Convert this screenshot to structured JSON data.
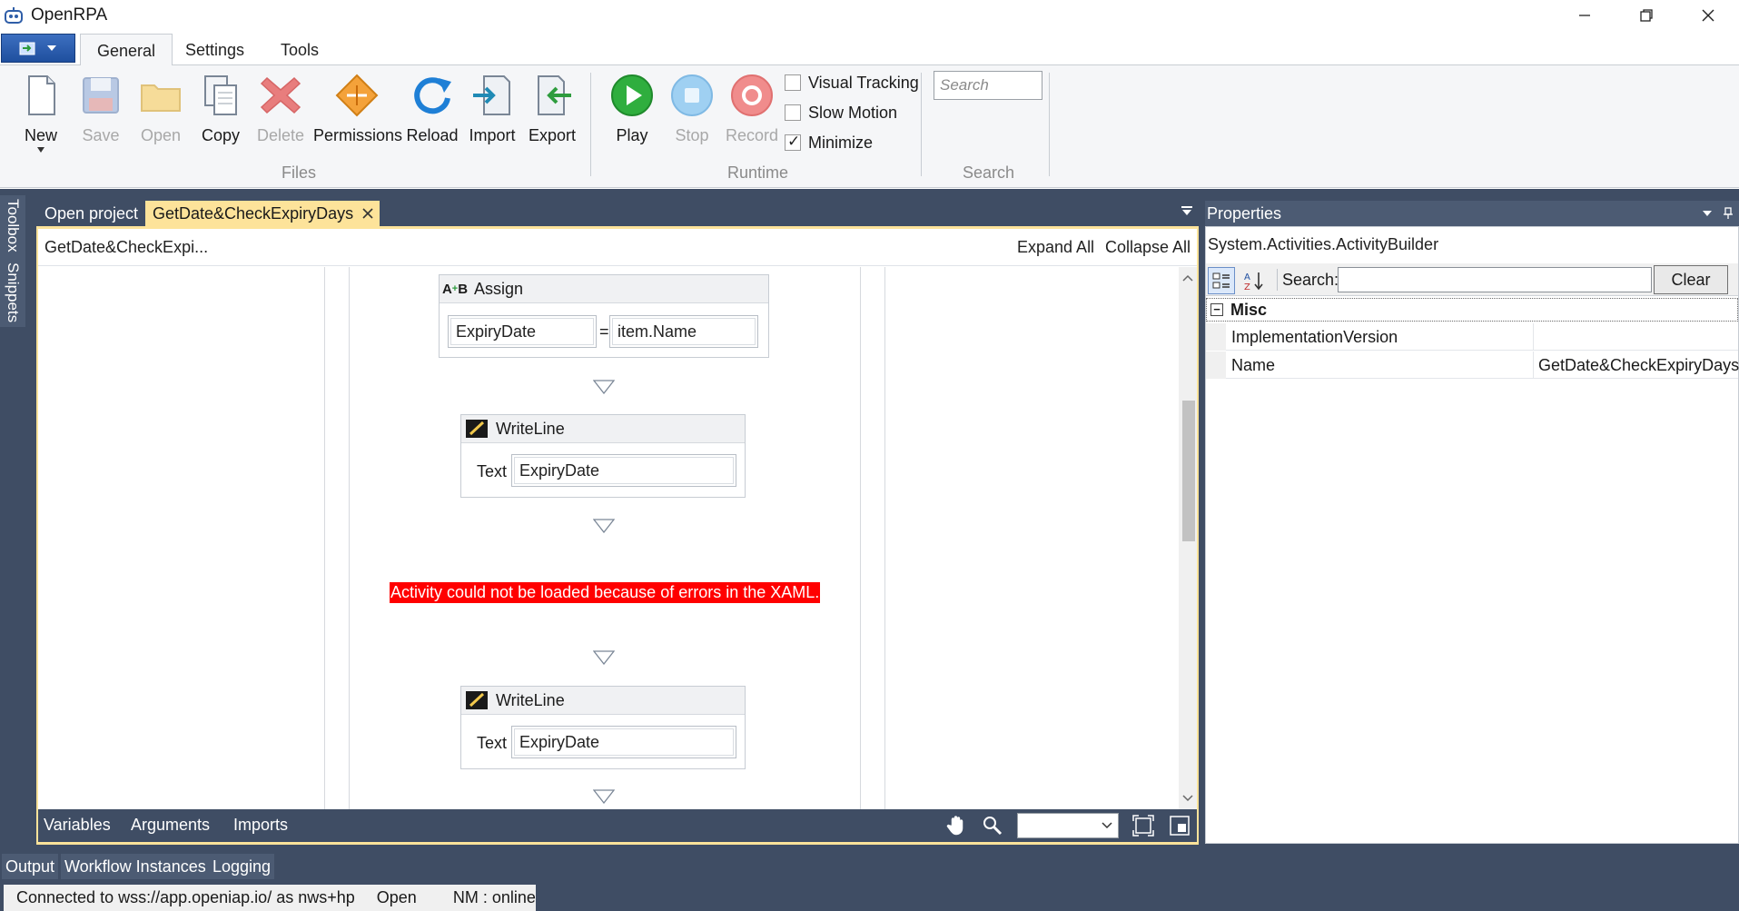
{
  "app": {
    "title": "OpenRPA"
  },
  "ribbon": {
    "tabs": [
      {
        "label": "General",
        "active": true
      },
      {
        "label": "Settings",
        "active": false
      },
      {
        "label": "Tools",
        "active": false
      }
    ],
    "files": {
      "group_label": "Files",
      "buttons": [
        {
          "label": "New",
          "icon": "new-file-icon",
          "enabled": true
        },
        {
          "label": "Save",
          "icon": "save-icon",
          "enabled": false
        },
        {
          "label": "Open",
          "icon": "folder-icon",
          "enabled": false
        },
        {
          "label": "Copy",
          "icon": "copy-icon",
          "enabled": true
        },
        {
          "label": "Delete",
          "icon": "delete-icon",
          "enabled": false
        },
        {
          "label": "Permissions",
          "icon": "permissions-icon",
          "enabled": true
        },
        {
          "label": "Reload",
          "icon": "reload-icon",
          "enabled": true
        },
        {
          "label": "Import",
          "icon": "import-icon",
          "enabled": true
        },
        {
          "label": "Export",
          "icon": "export-icon",
          "enabled": true
        }
      ]
    },
    "runtime": {
      "group_label": "Runtime",
      "buttons": [
        {
          "label": "Play",
          "icon": "play-icon",
          "enabled": true
        },
        {
          "label": "Stop",
          "icon": "stop-icon",
          "enabled": false
        },
        {
          "label": "Record",
          "icon": "record-icon",
          "enabled": false
        }
      ],
      "checkboxes": [
        {
          "label": "Visual Tracking",
          "checked": false
        },
        {
          "label": "Slow Motion",
          "checked": false
        },
        {
          "label": "Minimize",
          "checked": true
        }
      ]
    },
    "search": {
      "group_label": "Search",
      "placeholder": "Search"
    }
  },
  "left_rail": {
    "toolbox": "Toolbox",
    "snippets": "Snippets"
  },
  "doc_tabs": [
    {
      "label": "Open project",
      "active": false
    },
    {
      "label": "GetDate&CheckExpiryDays",
      "active": true
    }
  ],
  "designer": {
    "breadcrumb": "GetDate&CheckExpi...",
    "expand_all": "Expand All",
    "collapse_all": "Collapse All",
    "assign": {
      "title": "Assign",
      "to": "ExpiryDate",
      "equals": "=",
      "value": "item.Name"
    },
    "writeline1": {
      "title": "WriteLine",
      "text_label": "Text",
      "text_value": "ExpiryDate"
    },
    "error": "Activity could not be loaded because of errors in the XAML.",
    "writeline2": {
      "title": "WriteLine",
      "text_label": "Text",
      "text_value": "ExpiryDate"
    },
    "bottom_tabs": [
      "Variables",
      "Arguments",
      "Imports"
    ]
  },
  "properties": {
    "title": "Properties",
    "type_name": "System.Activities.ActivityBuilder",
    "search_label": "Search:",
    "clear_label": "Clear",
    "category": "Misc",
    "rows": [
      {
        "name": "ImplementationVersion",
        "value": ""
      },
      {
        "name": "Name",
        "value": "GetDate&CheckExpiryDays"
      }
    ]
  },
  "bottom_tabs": [
    "Output",
    "Workflow Instances",
    "Logging"
  ],
  "status": {
    "connection": "Connected to wss://app.openiap.io/ as nws+hp",
    "state": "Open",
    "nm": "NM : online"
  },
  "colors": {
    "workspace": "#3f4d64",
    "active_tab": "#fde39a",
    "error_bg": "#ff0000",
    "ribbon_bg": "#f5f6f8"
  }
}
